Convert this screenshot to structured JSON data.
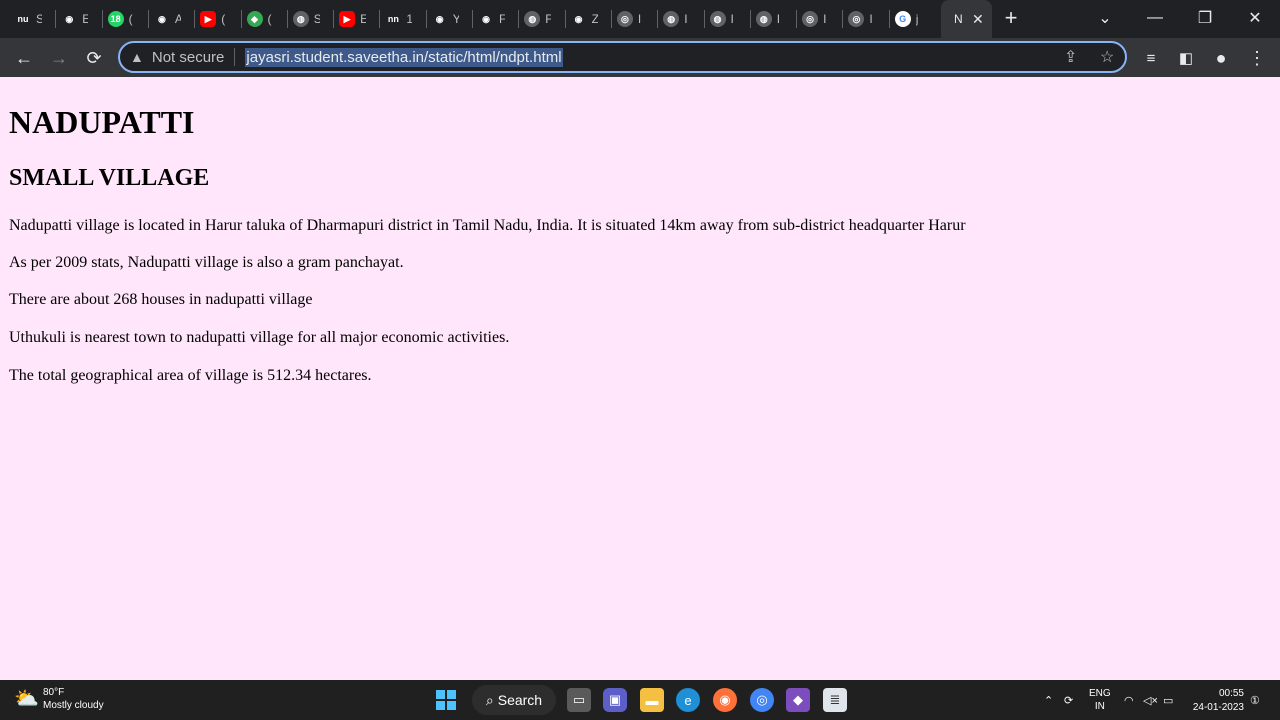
{
  "tabs": [
    {
      "name": "tab-1",
      "favicon": "nu",
      "label": "S",
      "color": "#202124"
    },
    {
      "name": "tab-2",
      "favicon": "github-icon",
      "label": "E",
      "color": "#202124"
    },
    {
      "name": "tab-3",
      "favicon": "whatsapp-icon",
      "label": "(",
      "color": "#25d366",
      "badge": "18"
    },
    {
      "name": "tab-4",
      "favicon": "github-icon",
      "label": "A",
      "color": "#202124"
    },
    {
      "name": "tab-5",
      "favicon": "youtube-icon",
      "label": "(",
      "color": "#ff0000"
    },
    {
      "name": "tab-6",
      "favicon": "maps-icon",
      "label": "(",
      "color": "#34a853"
    },
    {
      "name": "tab-7",
      "favicon": "globe-icon",
      "label": "S",
      "color": "#5f6368"
    },
    {
      "name": "tab-8",
      "favicon": "youtube-icon",
      "label": "E",
      "color": "#ff0000"
    },
    {
      "name": "tab-9",
      "favicon": "nn",
      "label": "1",
      "color": "#202124"
    },
    {
      "name": "tab-10",
      "favicon": "github-icon",
      "label": "Y",
      "color": "#202124"
    },
    {
      "name": "tab-11",
      "favicon": "github-icon",
      "label": "F",
      "color": "#202124"
    },
    {
      "name": "tab-12",
      "favicon": "globe-icon",
      "label": "F",
      "color": "#5f6368"
    },
    {
      "name": "tab-13",
      "favicon": "github-icon",
      "label": "Z",
      "color": "#202124"
    },
    {
      "name": "tab-14",
      "favicon": "chrome-icon",
      "label": "I",
      "color": "#5f6368"
    },
    {
      "name": "tab-15",
      "favicon": "globe-icon",
      "label": "I",
      "color": "#5f6368"
    },
    {
      "name": "tab-16",
      "favicon": "globe-icon",
      "label": "I",
      "color": "#5f6368"
    },
    {
      "name": "tab-17",
      "favicon": "globe-icon",
      "label": "I",
      "color": "#5f6368"
    },
    {
      "name": "tab-18",
      "favicon": "chrome-icon",
      "label": "I",
      "color": "#5f6368"
    },
    {
      "name": "tab-19",
      "favicon": "chrome-icon",
      "label": "I",
      "color": "#5f6368"
    },
    {
      "name": "tab-20",
      "favicon": "google-icon",
      "label": "j",
      "color": "#ffffff"
    }
  ],
  "active_tab": {
    "label": "N",
    "close": "✕"
  },
  "toolbar": {
    "not_secure": "Not secure",
    "url": "jayasri.student.saveetha.in/static/html/ndpt.html"
  },
  "page": {
    "h1": "NADUPATTI",
    "h2": "SMALL VILLAGE",
    "paragraphs": [
      "Nadupatti village is located in Harur taluka of Dharmapuri district in Tamil Nadu, India. It is situated 14km away from sub-district headquarter Harur",
      "As per 2009 stats, Nadupatti village is also a gram panchayat.",
      "There are about 268 houses in nadupatti village",
      "Uthukuli is nearest town to nadupatti village for all major economic activities.",
      "The total geographical area of village is 512.34 hectares."
    ]
  },
  "taskbar": {
    "weather_temp": "80°F",
    "weather_desc": "Mostly cloudy",
    "search_label": "Search",
    "lang_1": "ENG",
    "lang_2": "IN",
    "time": "00:55",
    "date": "24-01-2023"
  },
  "colors": {
    "page_bg": "#ffe6fa",
    "omnibox_border": "#8ab4f8"
  }
}
